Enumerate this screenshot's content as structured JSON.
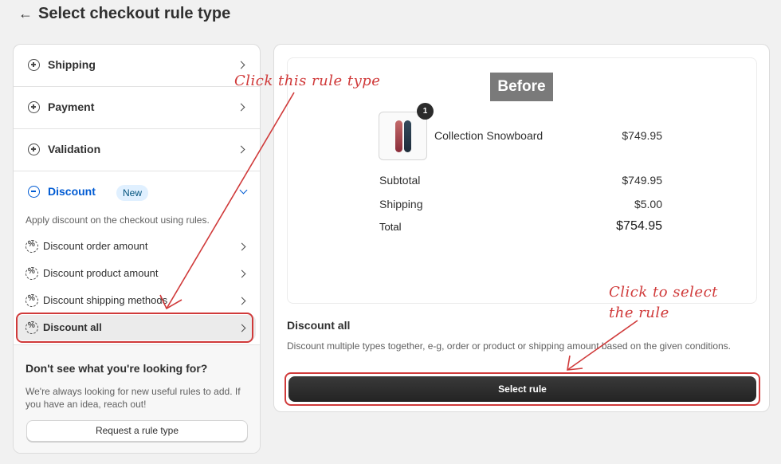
{
  "header": {
    "back_icon": "arrow-left-icon",
    "title": "Select checkout rule type"
  },
  "rule_types": [
    {
      "label": "Shipping",
      "icon": "plus-circle-icon"
    },
    {
      "label": "Payment",
      "icon": "plus-circle-icon"
    },
    {
      "label": "Validation",
      "icon": "plus-circle-icon"
    }
  ],
  "discount": {
    "label": "Discount",
    "badge": "New",
    "icon": "minus-circle-icon",
    "description": "Apply discount on the checkout using rules.",
    "items": [
      {
        "label": "Discount order amount",
        "icon": "discount-icon"
      },
      {
        "label": "Discount product amount",
        "icon": "discount-icon"
      },
      {
        "label": "Discount shipping methods",
        "icon": "discount-icon"
      },
      {
        "label": "Discount all",
        "icon": "discount-icon",
        "selected": true
      }
    ]
  },
  "help": {
    "title": "Don't see what you're looking for?",
    "text": "We're always looking for new useful rules to add. If you have an idea, reach out!",
    "button": "Request a rule type"
  },
  "preview": {
    "tag": "Before",
    "product": {
      "name": "Collection Snowboard",
      "price": "$749.95",
      "quantity": "1"
    },
    "subtotal_label": "Subtotal",
    "subtotal_value": "$749.95",
    "shipping_label": "Shipping",
    "shipping_value": "$5.00",
    "total_label": "Total",
    "total_value": "$754.95"
  },
  "selected_rule": {
    "name": "Discount all",
    "description": "Discount multiple types together, e-g, order or product or shipping amount based on the given conditions.",
    "button": "Select rule"
  },
  "annotations": {
    "left_note": "Click this rule type",
    "right_note_line1": "Click to select",
    "right_note_line2": "the rule",
    "color": "#d03a3a"
  },
  "colors": {
    "accent": "#005bd3",
    "badge_bg": "#e0f0ff",
    "primary_button": "#303030"
  }
}
